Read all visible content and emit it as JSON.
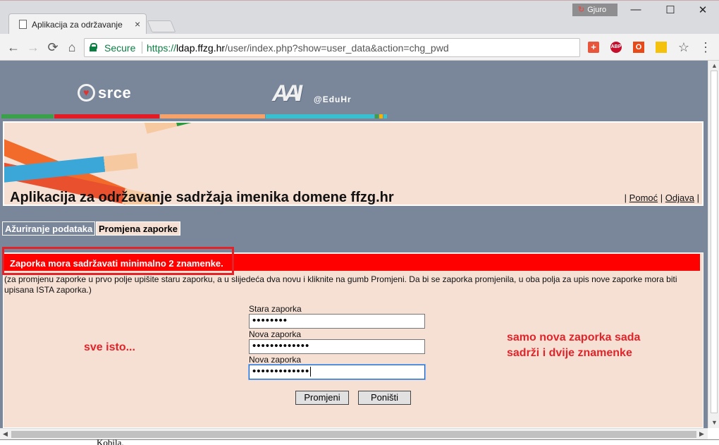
{
  "browser": {
    "tab_title": "Aplikacija za održavanje s",
    "tab_close": "×",
    "profile_name": "Gjuro",
    "window_min": "—",
    "window_max": "☐",
    "window_close": "✕",
    "nav": {
      "back": "←",
      "forward": "→",
      "reload": "⟳",
      "home": "⌂"
    },
    "secure_label": "Secure",
    "url_scheme": "https://",
    "url_host": "ldap.ffzg.hr",
    "url_rest": "/user/index.php?show=user_data&action=chg_pwd",
    "extensions": [
      {
        "name": "plus-extension",
        "label": "+",
        "color": "#e8553b"
      },
      {
        "name": "adblock-extension",
        "label": "ABP",
        "color": "#c70d2c"
      },
      {
        "name": "office-extension",
        "label": "O",
        "color": "#e64a19"
      },
      {
        "name": "note-extension",
        "label": "",
        "color": "#f4c20d"
      }
    ],
    "star": "☆",
    "menu": "⋮"
  },
  "header": {
    "srce_logo": "srce",
    "aai_logo": "AAI",
    "eduhr_logo": "@EduHr",
    "stripe_colors": [
      "#3aa04a",
      "#e21b25",
      "#f7a268",
      "#38bfd0",
      "#f4b400"
    ]
  },
  "banner": {
    "title": "Aplikacija za održavanje sadržaja imenika domene ffzg.hr",
    "link_help": "Pomoć",
    "link_logout": "Odjava",
    "separator": "|"
  },
  "tabs": [
    {
      "label": "Ažuriranje podataka",
      "active": false
    },
    {
      "label": "Promjena zaporke",
      "active": true
    }
  ],
  "form": {
    "error": "Zaporka mora sadržavati minimalno 2 znamenke.",
    "instructions": "(za promjenu zaporke u prvo polje upišite staru zaporku, a u slijedeća dva novu i kliknite na gumb Promjeni. Da bi se zaporka promjenila, u oba polja za upis nove zaporke mora biti upisana ISTA zaporka.)",
    "old_label": "Stara zaporka",
    "old_value": "••••••••",
    "new_label": "Nova zaporka",
    "new_value": "•••••••••••••",
    "confirm_label": "Nova zaporka",
    "confirm_value": "•••••••••••••",
    "submit": "Promjeni",
    "reset": "Poništi"
  },
  "annotations": {
    "left": "sve isto...",
    "right_line1": "samo nova zaporka sada",
    "right_line2": "sadrži i dvije znamenke"
  },
  "below_text": "Kobila."
}
